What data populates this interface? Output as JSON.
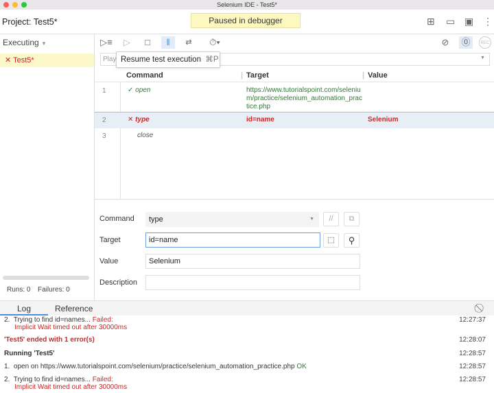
{
  "window": {
    "title": "Selenium IDE - Test5*"
  },
  "header": {
    "project_label": "Project:",
    "project_name": "Test5*",
    "status": "Paused in debugger"
  },
  "header_icons": [
    "new-project-icon",
    "open-folder-icon",
    "save-icon",
    "more-icon"
  ],
  "sidebar": {
    "dropdown": "Executing",
    "tests": [
      {
        "name": "Test5*",
        "status": "failed",
        "mark": "✕"
      }
    ],
    "runs": "Runs: 0",
    "failures": "Failures: 0"
  },
  "toolbar": {
    "icons": [
      "run-all-icon",
      "run-icon",
      "stop-icon",
      "pause-icon",
      "step-over-icon",
      "speed-icon",
      "disable-breakpoints-icon",
      "pause-on-exceptions-icon",
      "record-icon"
    ],
    "record_label": "REC"
  },
  "playback": {
    "placeholder": "Playback base URL"
  },
  "tooltip": {
    "text": "Resume test execution",
    "shortcut": "⌘P"
  },
  "table": {
    "headers": [
      "Command",
      "Target",
      "Value"
    ],
    "rows": [
      {
        "num": "1",
        "mark": "✓",
        "command": "open",
        "target": "https://www.tutorialspoint.com/selenium/practice/selenium_automation_practice.php",
        "value": "",
        "status": "passed"
      },
      {
        "num": "2",
        "mark": "✕",
        "command": "type",
        "target": "id=name",
        "value": "Selenium",
        "status": "failed"
      },
      {
        "num": "3",
        "mark": "",
        "command": "close",
        "target": "",
        "value": "",
        "status": "pending"
      }
    ]
  },
  "editor": {
    "command_label": "Command",
    "command_value": "type",
    "target_label": "Target",
    "target_value": "id=name",
    "value_label": "Value",
    "value_value": "Selenium",
    "description_label": "Description",
    "description_value": "",
    "comment_btn": "//"
  },
  "log_tabs": [
    "Log",
    "Reference"
  ],
  "log": [
    {
      "num": "2.",
      "text": "Trying to find id=names...",
      "status": "Failed:",
      "detail": "Implicit Wait timed out after 30000ms",
      "time": "12:27:37"
    },
    {
      "text": "'Test5' ended with 1 error(s)",
      "time": "12:28:07"
    },
    {
      "text": "Running 'Test5'",
      "time": "12:28:57"
    },
    {
      "num": "1.",
      "text": "open on https://www.tutorialspoint.com/selenium/practice/selenium_automation_practice.php",
      "status": "OK",
      "time": "12:28:57"
    },
    {
      "num": "2.",
      "text": "Trying to find id=names...",
      "status": "Failed:",
      "detail": "Implicit Wait timed out after 30000ms",
      "time": "12:28:57"
    }
  ],
  "colors": {
    "paused_bg": "#fdf8c0",
    "error": "#c62828",
    "success": "#2e7d32",
    "selected_row": "#e8eef6",
    "accent": "#4a90d9"
  }
}
